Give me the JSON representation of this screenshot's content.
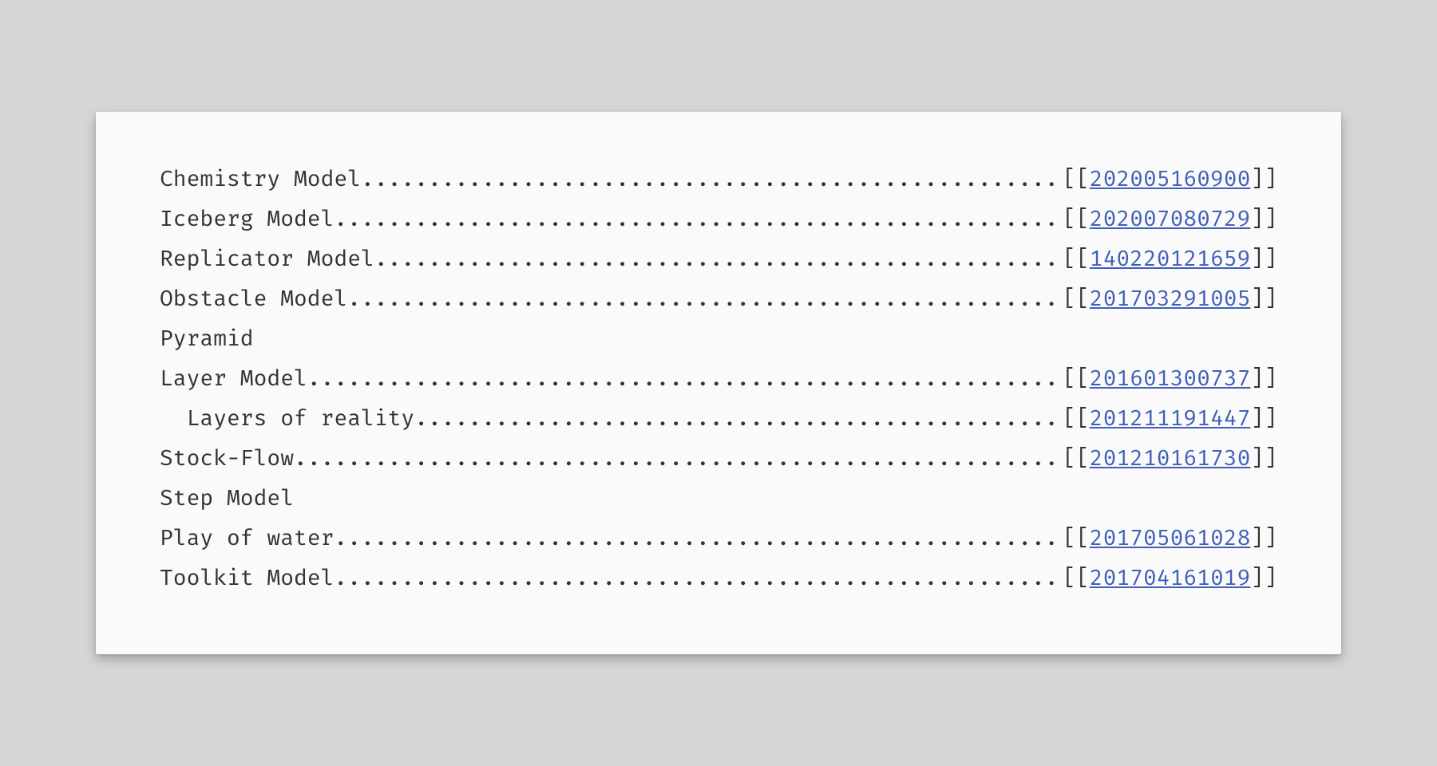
{
  "entries": [
    {
      "label": "Chemistry Model",
      "link": "202005160900",
      "indent": 0
    },
    {
      "label": "Iceberg Model",
      "link": "202007080729",
      "indent": 0
    },
    {
      "label": "Replicator Model",
      "link": "140220121659",
      "indent": 0
    },
    {
      "label": "Obstacle Model",
      "link": "201703291005",
      "indent": 0
    },
    {
      "label": "Pyramid",
      "link": null,
      "indent": 0
    },
    {
      "label": "Layer Model",
      "link": "201601300737",
      "indent": 0
    },
    {
      "label": "Layers of reality",
      "link": "201211191447",
      "indent": 1
    },
    {
      "label": "Stock-Flow",
      "link": "201210161730",
      "indent": 0
    },
    {
      "label": "Step Model",
      "link": null,
      "indent": 0
    },
    {
      "label": "Play of water",
      "link": "201705061028",
      "indent": 0
    },
    {
      "label": "Toolkit Model",
      "link": "201704161019",
      "indent": 0
    }
  ],
  "brackets": {
    "open": "[[",
    "close": "]]"
  }
}
